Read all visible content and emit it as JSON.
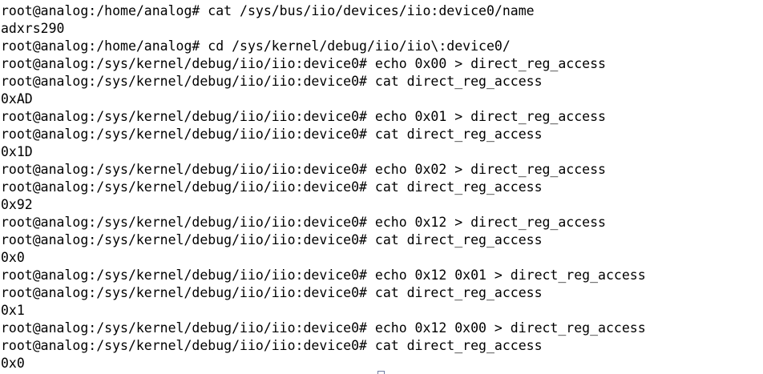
{
  "terminal": {
    "lines": [
      "root@analog:/home/analog# cat /sys/bus/iio/devices/iio:device0/name",
      "adxrs290",
      "root@analog:/home/analog# cd /sys/kernel/debug/iio/iio\\:device0/",
      "root@analog:/sys/kernel/debug/iio/iio:device0# echo 0x00 > direct_reg_access",
      "root@analog:/sys/kernel/debug/iio/iio:device0# cat direct_reg_access",
      "0xAD",
      "root@analog:/sys/kernel/debug/iio/iio:device0# echo 0x01 > direct_reg_access",
      "root@analog:/sys/kernel/debug/iio/iio:device0# cat direct_reg_access",
      "0x1D",
      "root@analog:/sys/kernel/debug/iio/iio:device0# echo 0x02 > direct_reg_access",
      "root@analog:/sys/kernel/debug/iio/iio:device0# cat direct_reg_access",
      "0x92",
      "root@analog:/sys/kernel/debug/iio/iio:device0# echo 0x12 > direct_reg_access",
      "root@analog:/sys/kernel/debug/iio/iio:device0# cat direct_reg_access",
      "0x0",
      "root@analog:/sys/kernel/debug/iio/iio:device0# echo 0x12 0x01 > direct_reg_access",
      "root@analog:/sys/kernel/debug/iio/iio:device0# cat direct_reg_access",
      "0x1",
      "root@analog:/sys/kernel/debug/iio/iio:device0# echo 0x12 0x00 > direct_reg_access",
      "root@analog:/sys/kernel/debug/iio/iio:device0# cat direct_reg_access",
      "0x0"
    ]
  }
}
